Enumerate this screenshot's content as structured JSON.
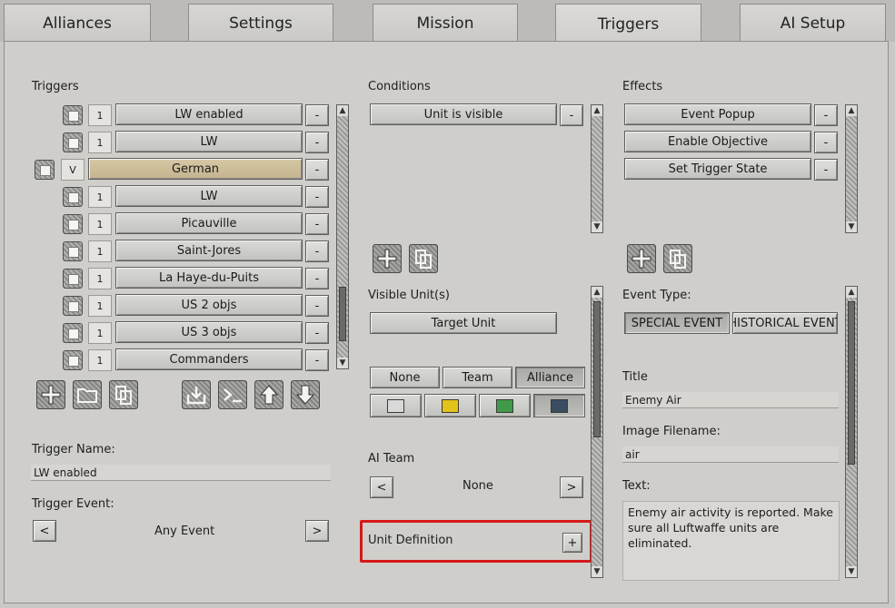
{
  "tabs": [
    {
      "label": "Alliances",
      "active": false
    },
    {
      "label": "Settings",
      "active": false
    },
    {
      "label": "Mission",
      "active": false
    },
    {
      "label": "Triggers",
      "active": true
    },
    {
      "label": "AI Setup",
      "active": false
    }
  ],
  "triggers": {
    "heading": "Triggers",
    "items": [
      {
        "count": "1",
        "name": "LW enabled",
        "remove": "-"
      },
      {
        "count": "1",
        "name": "LW",
        "remove": "-"
      },
      {
        "count": "V",
        "name": "German",
        "remove": "-",
        "selected": true
      },
      {
        "count": "1",
        "name": "LW",
        "remove": "-"
      },
      {
        "count": "1",
        "name": "Picauville",
        "remove": "-"
      },
      {
        "count": "1",
        "name": "Saint-Jores",
        "remove": "-"
      },
      {
        "count": "1",
        "name": "La Haye-du-Puits",
        "remove": "-"
      },
      {
        "count": "1",
        "name": "US 2 objs",
        "remove": "-"
      },
      {
        "count": "1",
        "name": "US 3 objs",
        "remove": "-"
      },
      {
        "count": "1",
        "name": "Commanders",
        "remove": "-"
      }
    ],
    "name_label": "Trigger Name:",
    "name_value": "LW enabled",
    "event_label": "Trigger Event:",
    "event_value": "Any Event",
    "prev": "<",
    "next": ">"
  },
  "conditions": {
    "heading": "Conditions",
    "items": [
      {
        "name": "Unit is visible",
        "remove": "-"
      }
    ],
    "visible_units_label": "Visible Unit(s)",
    "target_unit": "Target Unit",
    "filter_options": [
      "None",
      "Team",
      "Alliance"
    ],
    "filter_selected": "Alliance",
    "team_colors": [
      "#d9d9d9",
      "#e3c21a",
      "#3f9a4a",
      "#3a4d62"
    ],
    "ai_team_label": "AI Team",
    "ai_team_value": "None",
    "prev": "<",
    "next": ">",
    "unit_definition_label": "Unit Definition",
    "unit_definition_button": "+"
  },
  "effects": {
    "heading": "Effects",
    "items": [
      {
        "name": "Event Popup",
        "remove": "-"
      },
      {
        "name": "Enable Objective",
        "remove": "-"
      },
      {
        "name": "Set Trigger State",
        "remove": "-"
      }
    ],
    "event_type_label": "Event Type:",
    "event_types": [
      "SPECIAL EVENT",
      "HISTORICAL EVENT"
    ],
    "title_label": "Title",
    "title_value": "Enemy Air",
    "image_label": "Image Filename:",
    "image_value": "air",
    "text_label": "Text:",
    "text_value": "Enemy air activity is reported. Make sure  all Luftwaffe units are eliminated."
  },
  "icons": {
    "add": "plus-icon",
    "folder": "folder-icon",
    "copy": "copy-icon",
    "import": "import-icon",
    "console": "console-icon",
    "move_up": "arrow-up-icon",
    "move_down": "arrow-down-icon"
  }
}
